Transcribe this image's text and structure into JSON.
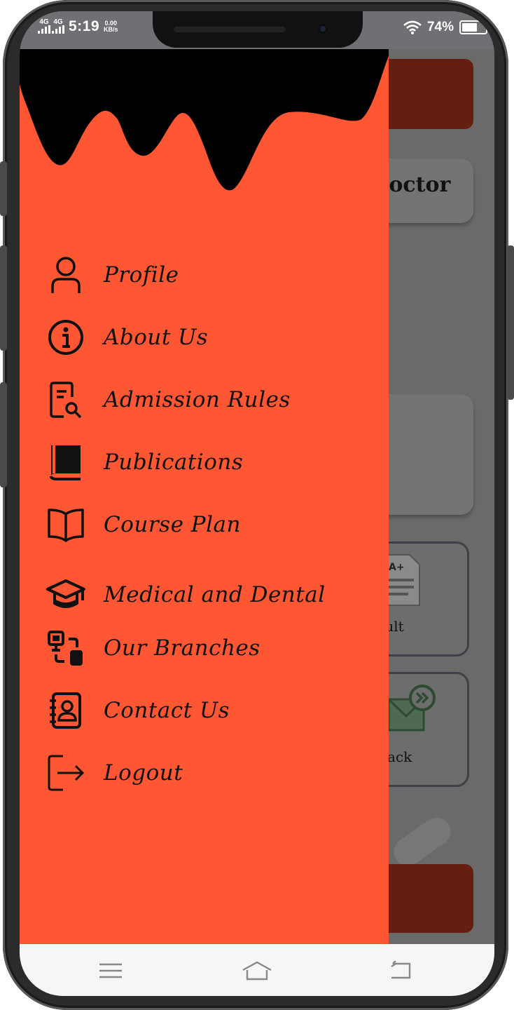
{
  "status_bar": {
    "network_1": "4G",
    "network_2": "4G",
    "time": "5:19",
    "speed_value": "0.00",
    "speed_unit": "KB/s",
    "battery_percent": "74%",
    "battery_level": 0.74,
    "icons": [
      "signal-icon",
      "wifi-icon",
      "battery-icon"
    ]
  },
  "background_app": {
    "card_title_fragment": "loctor",
    "tile_1_label_fragment": "n Result",
    "tile_2_label_fragment": "Feedback"
  },
  "drawer": {
    "background_color": "#ff5733",
    "items": [
      {
        "label": "Profile",
        "icon": "profile-icon"
      },
      {
        "label": "About Us",
        "icon": "info-icon"
      },
      {
        "label": "Admission Rules",
        "icon": "document-search-icon"
      },
      {
        "label": "Publications",
        "icon": "book-icon"
      },
      {
        "label": "Course Plan",
        "icon": "open-book-icon"
      },
      {
        "label": "Medical and Dental",
        "icon": "graduation-cap-icon"
      },
      {
        "label": "Our Branches",
        "icon": "branches-icon"
      },
      {
        "label": "Contact Us",
        "icon": "contact-book-icon"
      },
      {
        "label": "Logout",
        "icon": "logout-icon"
      }
    ]
  },
  "nav_bar": {
    "buttons": [
      "menu-icon",
      "home-icon",
      "back-icon"
    ]
  }
}
